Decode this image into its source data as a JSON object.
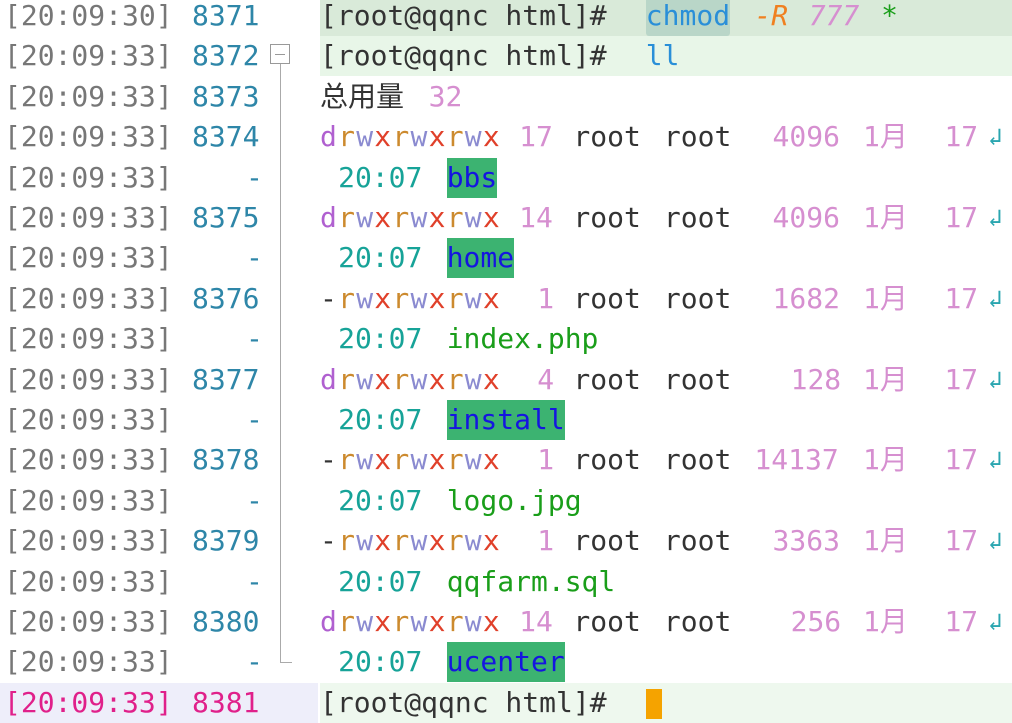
{
  "colors": {
    "timestamp": "#777777",
    "line_number": "#2e86a8",
    "current_line": "#e0208a",
    "prompt": "#333333",
    "command": "#2a8fd8",
    "option": "#f08020",
    "number": "#d68fd0",
    "time": "#17a398",
    "dir_bg": "#3cb371",
    "dir_fg": "#1515e0",
    "file": "#1a9e1a",
    "perm_r": "#cc8a2e",
    "perm_w": "#8a8ad0",
    "perm_x": "#e0402a",
    "perm_d": "#b060d0",
    "cursor": "#f5a300"
  },
  "lines": [
    {
      "ts": "[20:09:30]",
      "ln": "8371"
    },
    {
      "ts": "[20:09:33]",
      "ln": "8372"
    },
    {
      "ts": "[20:09:33]",
      "ln": "8373"
    },
    {
      "ts": "[20:09:33]",
      "ln": "8374"
    },
    {
      "ts": "[20:09:33]",
      "ln": "-"
    },
    {
      "ts": "[20:09:33]",
      "ln": "8375"
    },
    {
      "ts": "[20:09:33]",
      "ln": "-"
    },
    {
      "ts": "[20:09:33]",
      "ln": "8376"
    },
    {
      "ts": "[20:09:33]",
      "ln": "-"
    },
    {
      "ts": "[20:09:33]",
      "ln": "8377"
    },
    {
      "ts": "[20:09:33]",
      "ln": "-"
    },
    {
      "ts": "[20:09:33]",
      "ln": "8378"
    },
    {
      "ts": "[20:09:33]",
      "ln": "-"
    },
    {
      "ts": "[20:09:33]",
      "ln": "8379"
    },
    {
      "ts": "[20:09:33]",
      "ln": "-"
    },
    {
      "ts": "[20:09:33]",
      "ln": "8380"
    },
    {
      "ts": "[20:09:33]",
      "ln": "-"
    },
    {
      "ts": "[20:09:33]",
      "ln": "8381"
    }
  ],
  "cmd1": {
    "prompt": "[root@qqnc html]#",
    "command": "chmod",
    "option": "-R",
    "mode": "777",
    "arg": "*"
  },
  "cmd2": {
    "prompt": "[root@qqnc html]#",
    "command": "ll"
  },
  "total": {
    "label": "总用量",
    "value": "32"
  },
  "entries": [
    {
      "perm_type": "d",
      "links": "17",
      "owner": "root",
      "group": "root",
      "size": "4096",
      "month": "1月",
      "day": "17",
      "time": "20:07",
      "name": "bbs",
      "is_dir": true
    },
    {
      "perm_type": "d",
      "links": "14",
      "owner": "root",
      "group": "root",
      "size": "4096",
      "month": "1月",
      "day": "17",
      "time": "20:07",
      "name": "home",
      "is_dir": true
    },
    {
      "perm_type": "-",
      "links": "1",
      "owner": "root",
      "group": "root",
      "size": "1682",
      "month": "1月",
      "day": "17",
      "time": "20:07",
      "name": "index.php",
      "is_dir": false
    },
    {
      "perm_type": "d",
      "links": "4",
      "owner": "root",
      "group": "root",
      "size": "128",
      "month": "1月",
      "day": "17",
      "time": "20:07",
      "name": "install",
      "is_dir": true
    },
    {
      "perm_type": "-",
      "links": "1",
      "owner": "root",
      "group": "root",
      "size": "14137",
      "month": "1月",
      "day": "17",
      "time": "20:07",
      "name": "logo.jpg",
      "is_dir": false
    },
    {
      "perm_type": "-",
      "links": "1",
      "owner": "root",
      "group": "root",
      "size": "3363",
      "month": "1月",
      "day": "17",
      "time": "20:07",
      "name": "qqfarm.sql",
      "is_dir": false
    },
    {
      "perm_type": "d",
      "links": "14",
      "owner": "root",
      "group": "root",
      "size": "256",
      "month": "1月",
      "day": "17",
      "time": "20:07",
      "name": "ucenter",
      "is_dir": true
    }
  ],
  "prompt3": "[root@qqnc html]#",
  "perm_chars": [
    "r",
    "w",
    "x",
    "r",
    "w",
    "x",
    "r",
    "w",
    "x"
  ],
  "wrap_icon": "wrap-arrow-icon"
}
